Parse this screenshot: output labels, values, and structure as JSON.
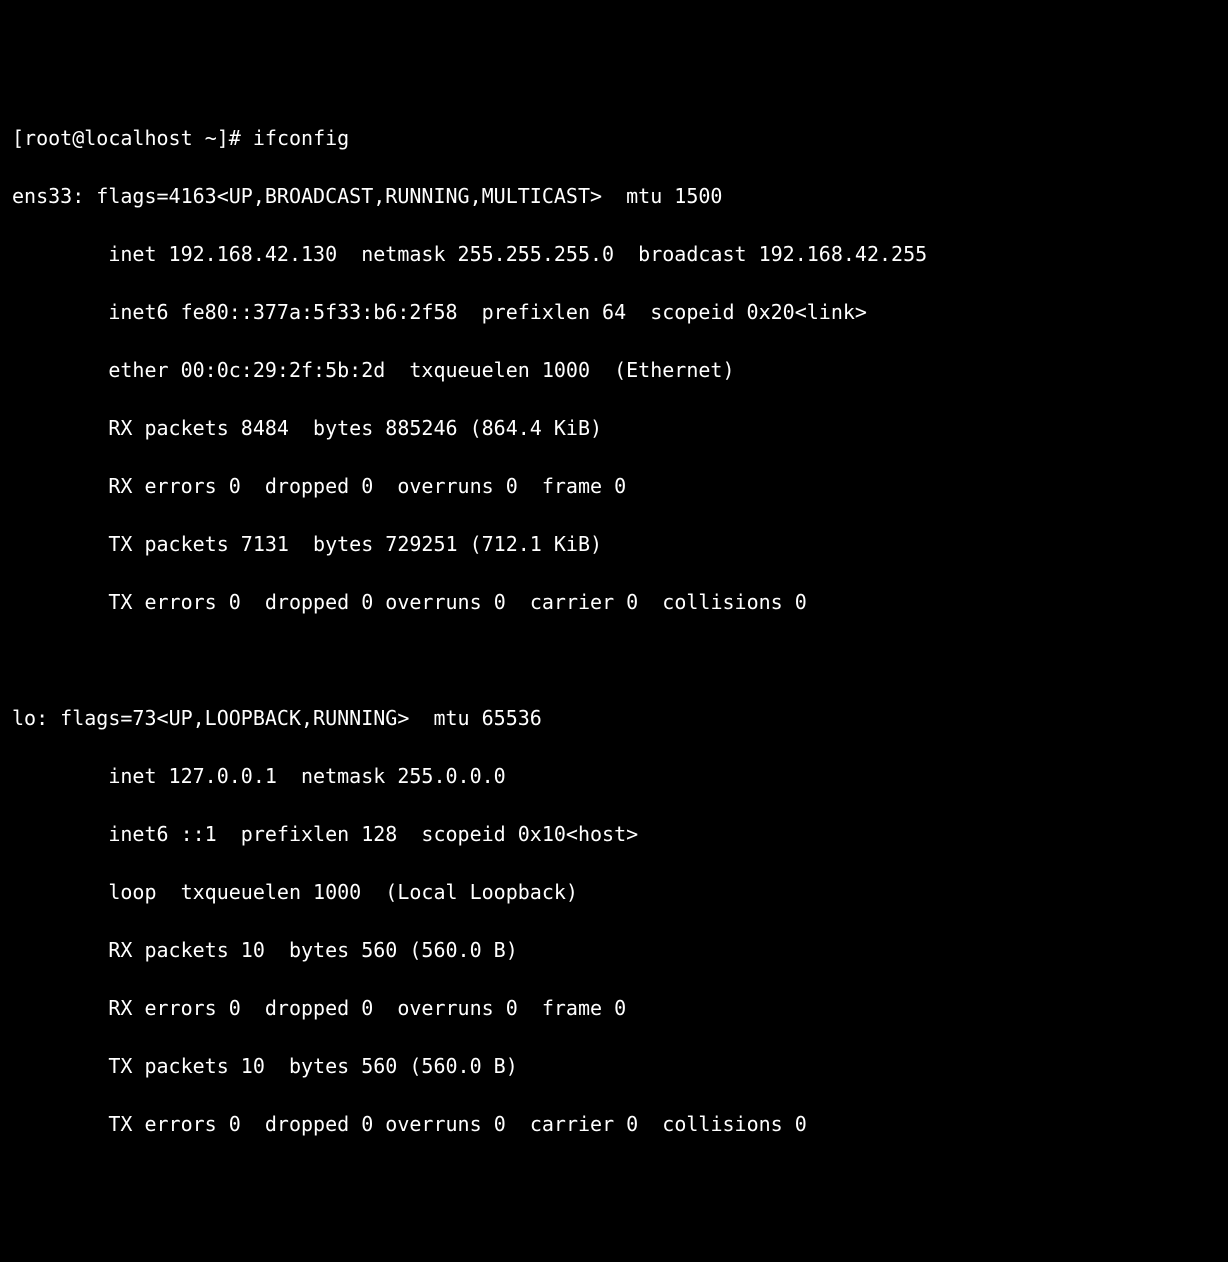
{
  "prompt": {
    "user": "root",
    "host": "localhost",
    "dir": "~",
    "symbol": "#",
    "command": "ifconfig"
  },
  "interfaces": [
    {
      "name": "ens33",
      "flags_num": "4163",
      "flags": "UP,BROADCAST,RUNNING,MULTICAST",
      "mtu": "1500",
      "inet": "192.168.42.130",
      "netmask": "255.255.255.0",
      "broadcast": "192.168.42.255",
      "inet6": "fe80::377a:5f33:b6:2f58",
      "prefixlen": "64",
      "scopeid": "0x20<link>",
      "ether": "00:0c:29:2f:5b:2d",
      "txqueuelen": "1000",
      "type": "Ethernet",
      "rx_packets": "8484",
      "rx_bytes": "885246",
      "rx_bytes_human": "864.4 KiB",
      "rx_errors": "0",
      "rx_dropped": "0",
      "rx_overruns": "0",
      "rx_frame": "0",
      "tx_packets": "7131",
      "tx_bytes": "729251",
      "tx_bytes_human": "712.1 KiB",
      "tx_errors": "0",
      "tx_dropped": "0",
      "tx_overruns": "0",
      "tx_carrier": "0",
      "tx_collisions": "0"
    },
    {
      "name": "lo",
      "flags_num": "73",
      "flags": "UP,LOOPBACK,RUNNING",
      "mtu": "65536",
      "inet": "127.0.0.1",
      "netmask": "255.0.0.0",
      "inet6": "::1",
      "prefixlen": "128",
      "scopeid": "0x10<host>",
      "loop_txqueuelen": "1000",
      "loop_type": "Local Loopback",
      "rx_packets": "10",
      "rx_bytes": "560",
      "rx_bytes_human": "560.0 B",
      "rx_errors": "0",
      "rx_dropped": "0",
      "rx_overruns": "0",
      "rx_frame": "0",
      "tx_packets": "10",
      "tx_bytes": "560",
      "tx_bytes_human": "560.0 B",
      "tx_errors": "0",
      "tx_dropped": "0",
      "tx_overruns": "0",
      "tx_carrier": "0",
      "tx_collisions": "0"
    }
  ]
}
